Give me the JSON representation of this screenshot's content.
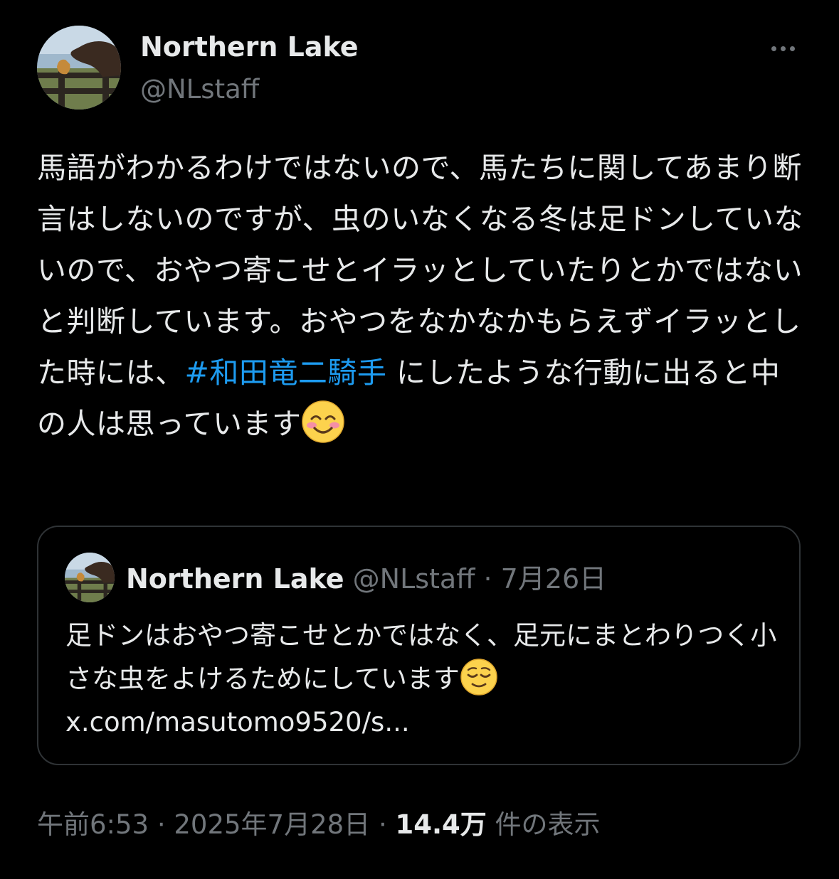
{
  "author": {
    "display_name": "Northern Lake",
    "handle": "@NLstaff"
  },
  "post": {
    "text_before": "馬語がわかるわけではないので、馬たちに関してあまり断言はしないのですが、虫のいなくなる冬は足ドンしていないので、おやつ寄こせとイラッとしていたりとかではないと判断しています。おやつをなかなかもらえずイラッとした時には、",
    "hashtag": "#和田竜二騎手",
    "text_after": " にしたような行動に出ると中の人は思っています",
    "emoji": "smiling-face-with-smiling-eyes-emoji"
  },
  "quote": {
    "display_name": "Northern Lake",
    "handle": "@NLstaff",
    "separator": " · ",
    "date": "7月26日",
    "text": "足ドンはおやつ寄こせとかではなく、足元にまとわりつく小さな虫をよけるためにしています",
    "emoji": "relieved-face-emoji",
    "link": "x.com/masutomo9520/s..."
  },
  "meta": {
    "time": "午前6:53",
    "date": "2025年7月28日",
    "separator": " · ",
    "views_count": "14.4万",
    "views_label": " 件の表示"
  },
  "colors": {
    "background": "#000000",
    "text": "#e7e9ea",
    "secondary": "#71767b",
    "link": "#1d9bf0",
    "border": "#2f3336"
  }
}
